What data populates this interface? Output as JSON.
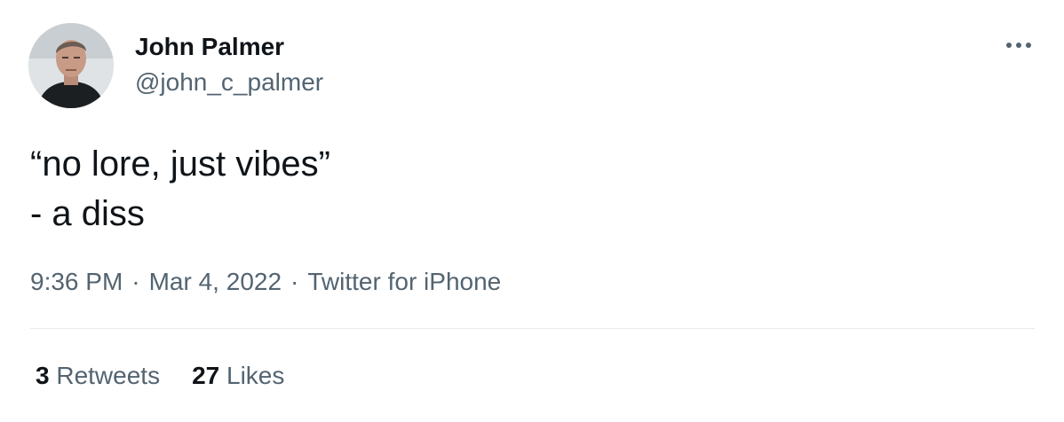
{
  "author": {
    "display_name": "John Palmer",
    "handle": "@john_c_palmer"
  },
  "tweet": {
    "text": "“no lore, just vibes”\n- a diss",
    "time": "9:36 PM",
    "date": "Mar 4, 2022",
    "source": "Twitter for iPhone",
    "separator": "·"
  },
  "stats": {
    "retweets_count": "3",
    "retweets_label": "Retweets",
    "likes_count": "27",
    "likes_label": "Likes"
  },
  "icons": {
    "more": "more-horizontal-icon"
  },
  "colors": {
    "text_primary": "#0f1419",
    "text_secondary": "#536471",
    "divider": "#e6ebee"
  }
}
